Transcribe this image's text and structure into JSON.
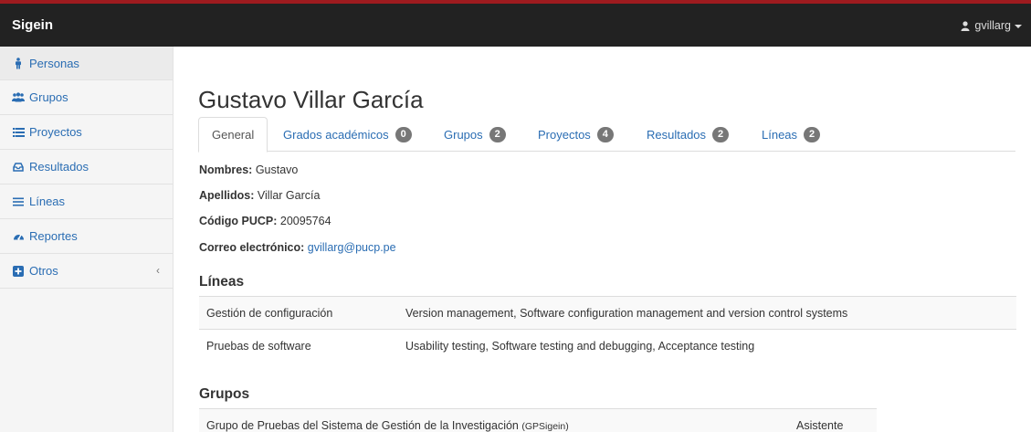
{
  "navbar": {
    "brand": "Sigein",
    "user": "gvillarg"
  },
  "sidebar": {
    "items": [
      {
        "label": "Personas",
        "icon": "person-icon"
      },
      {
        "label": "Grupos",
        "icon": "users-icon"
      },
      {
        "label": "Proyectos",
        "icon": "list-icon"
      },
      {
        "label": "Resultados",
        "icon": "inbox-icon"
      },
      {
        "label": "Líneas",
        "icon": "bars-icon"
      },
      {
        "label": "Reportes",
        "icon": "gauge-icon"
      },
      {
        "label": "Otros",
        "icon": "plus-square-icon"
      }
    ]
  },
  "colors": {
    "accent": "#2a6db3",
    "navbar": "#222222",
    "top_stripe": "#9e1b1f",
    "badge": "#777777"
  },
  "page": {
    "title": "Gustavo Villar García",
    "tabs": [
      {
        "label": "General",
        "badge": null
      },
      {
        "label": "Grados académicos",
        "badge": "0"
      },
      {
        "label": "Grupos",
        "badge": "2"
      },
      {
        "label": "Proyectos",
        "badge": "4"
      },
      {
        "label": "Resultados",
        "badge": "2"
      },
      {
        "label": "Líneas",
        "badge": "2"
      }
    ],
    "fields": {
      "nombres_label": "Nombres:",
      "nombres": "Gustavo",
      "apellidos_label": "Apellidos:",
      "apellidos": "Villar García",
      "codigo_label": "Código PUCP:",
      "codigo": "20095764",
      "correo_label": "Correo electrónico:",
      "correo": "gvillarg@pucp.pe"
    },
    "lineas": {
      "heading": "Líneas",
      "rows": [
        {
          "name": "Gestión de configuración",
          "topics": "Version management, Software configuration management and version control systems"
        },
        {
          "name": "Pruebas de software",
          "topics": "Usability testing, Software testing and debugging, Acceptance testing"
        }
      ]
    },
    "grupos": {
      "heading": "Grupos",
      "rows": [
        {
          "name": "Grupo de Pruebas del Sistema de Gestión de la Investigación",
          "abbr": "(GPSigein)",
          "role": "Asistente"
        }
      ]
    }
  }
}
